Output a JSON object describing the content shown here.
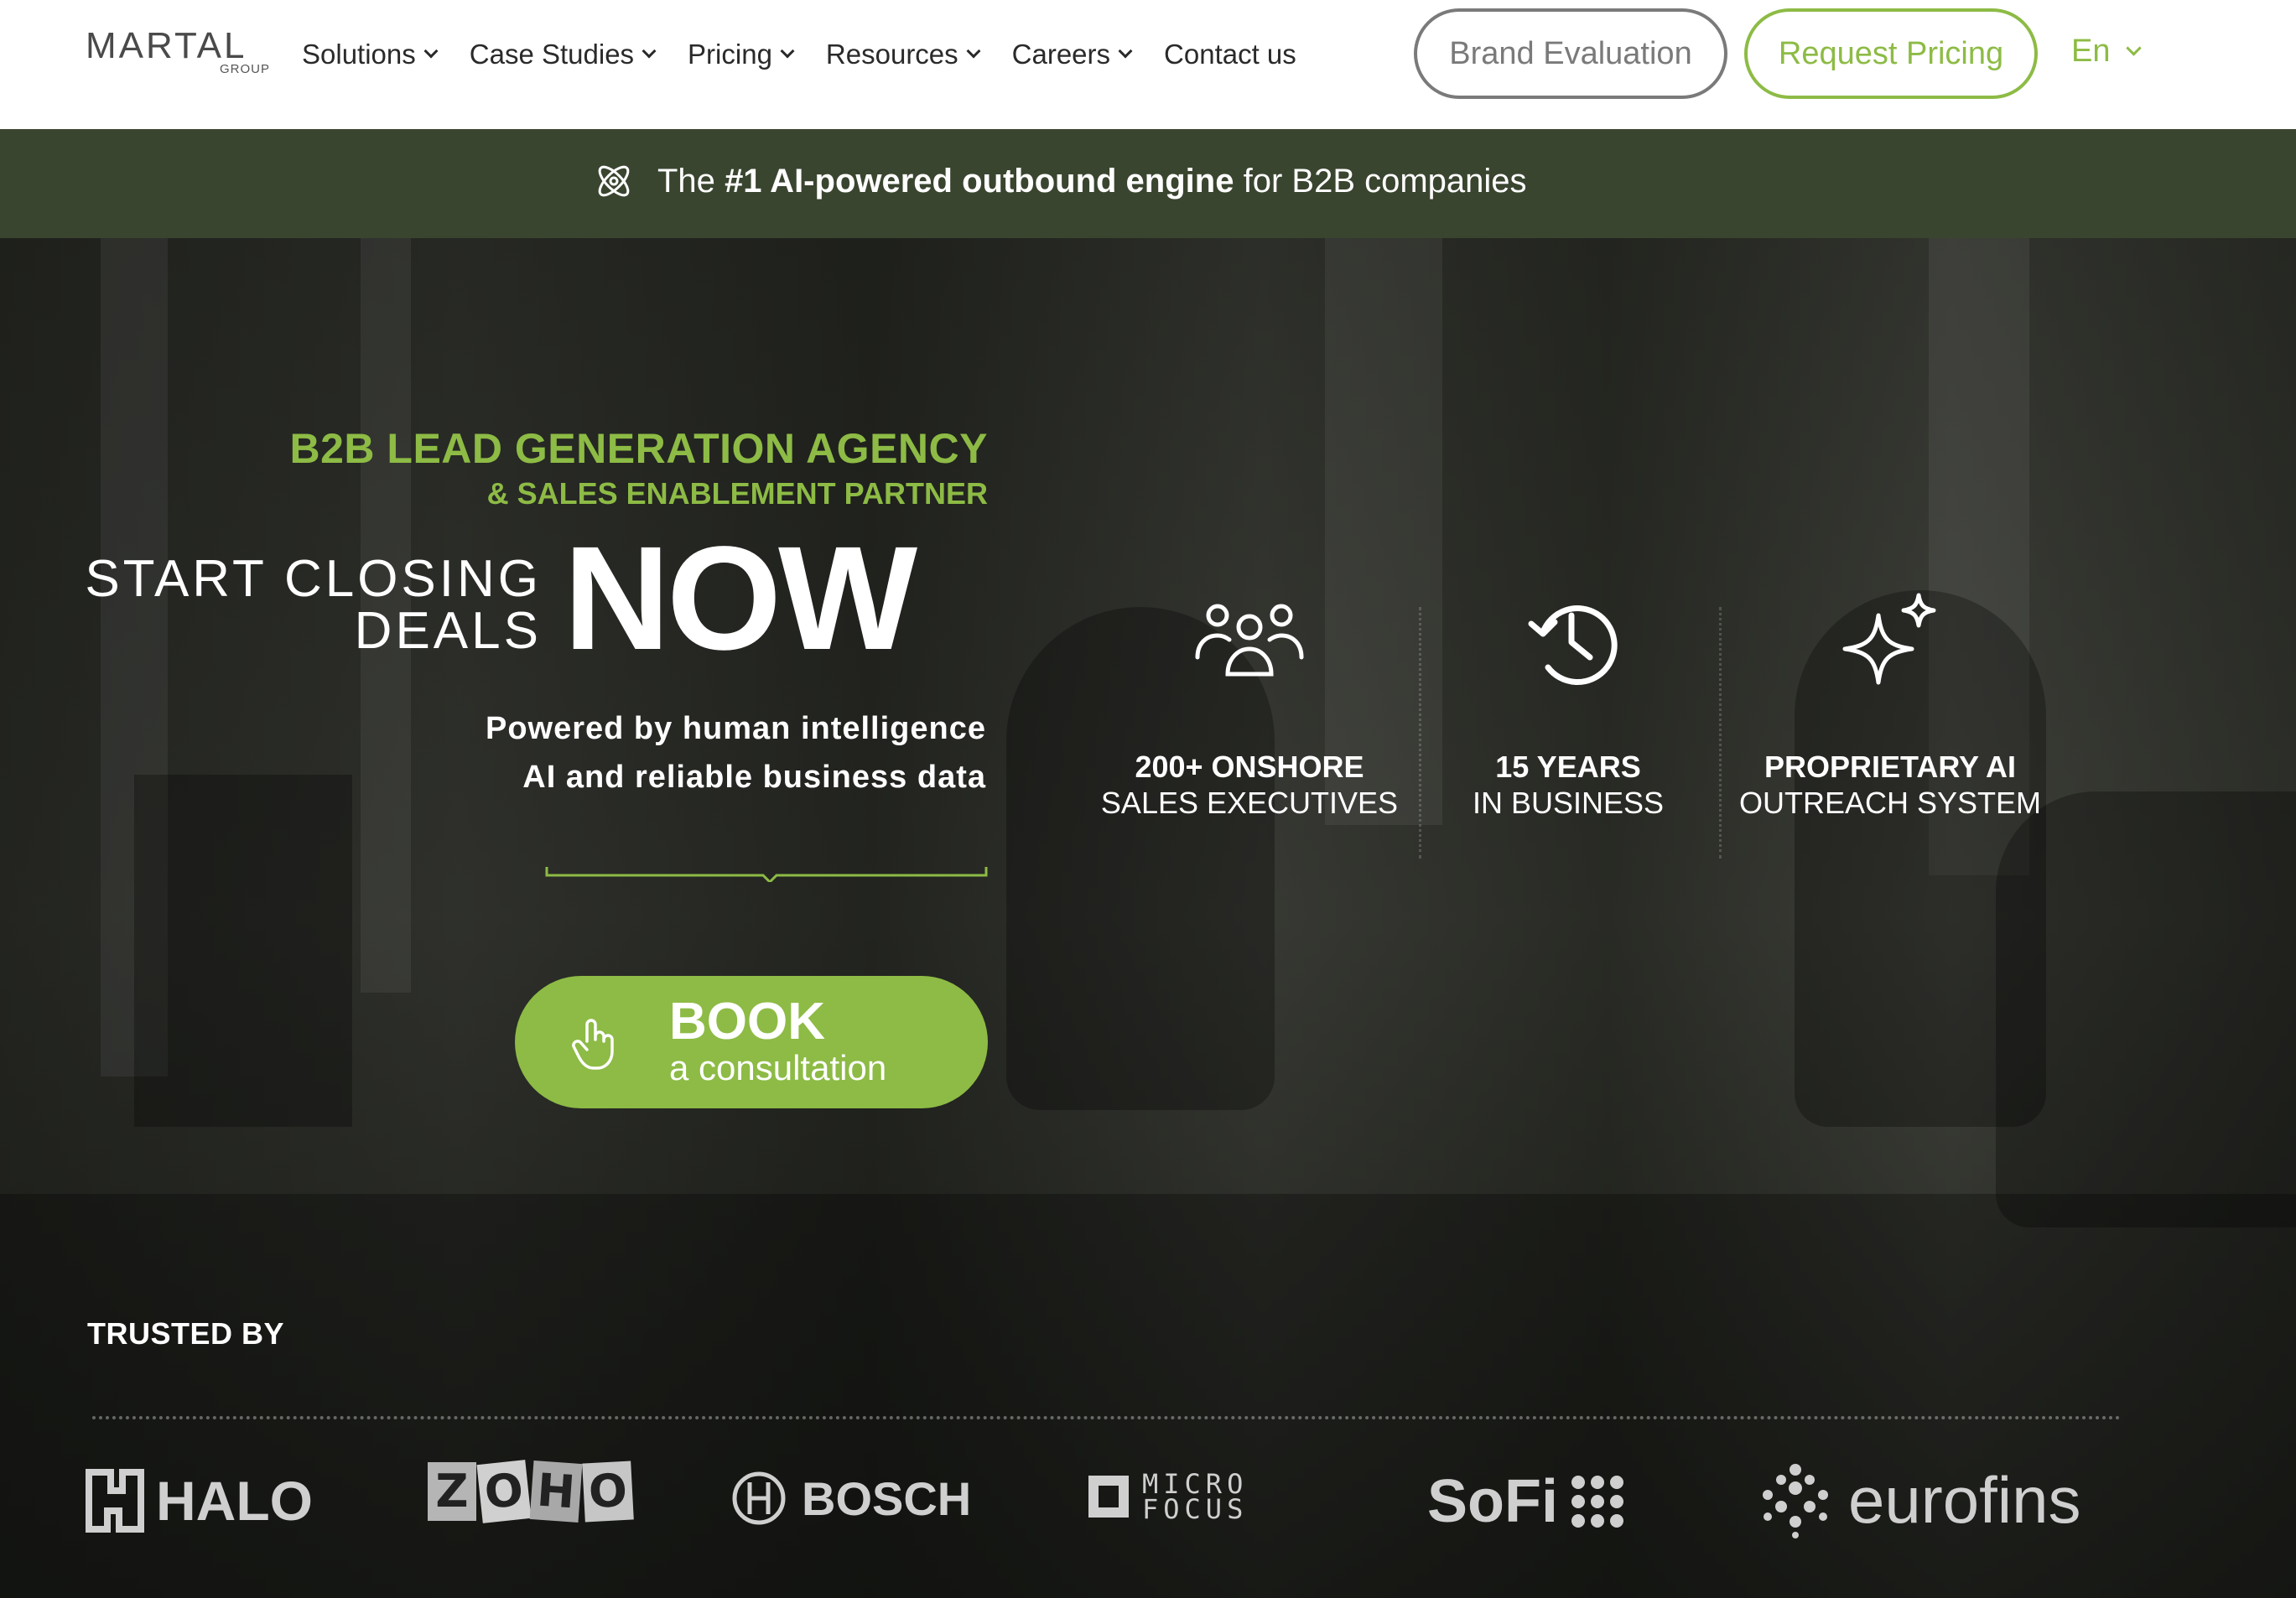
{
  "header": {
    "logo_main": "MARTAL",
    "logo_sub": "GROUP",
    "nav": [
      {
        "label": "Solutions"
      },
      {
        "label": "Case Studies"
      },
      {
        "label": "Pricing"
      },
      {
        "label": "Resources"
      },
      {
        "label": "Careers"
      },
      {
        "label": "Contact us"
      }
    ],
    "brand_evaluation_label": "Brand Evaluation",
    "request_pricing_label": "Request Pricing",
    "language": "En"
  },
  "banner": {
    "prefix": "The",
    "bold": "#1 AI-powered outbound engine",
    "suffix": "for B2B companies"
  },
  "hero": {
    "kicker": "B2B LEAD GENERATION AGENCY",
    "kicker_sub": "& SALES ENABLEMENT PARTNER",
    "start_line1": "START CLOSING",
    "start_line2": "DEALS",
    "now": "NOW",
    "power_line1": "Powered by human intelligence",
    "power_line2": "AI and reliable business data",
    "cta_main": "BOOK",
    "cta_sub": "a consultation",
    "stats": [
      {
        "bold": "200+ ONSHORE",
        "regular": "SALES EXECUTIVES",
        "icon": "team-icon"
      },
      {
        "bold": "15 YEARS",
        "regular": "IN BUSINESS",
        "icon": "history-clock-icon"
      },
      {
        "bold": "PROPRIETARY AI",
        "regular": "OUTREACH SYSTEM",
        "icon": "sparkle-icon"
      }
    ]
  },
  "trusted": {
    "label": "TRUSTED BY",
    "logos": {
      "halo": "HALO",
      "zoho": [
        "Z",
        "O",
        "H",
        "O"
      ],
      "bosch": "BOSCH",
      "micro_line1": "MICRO",
      "micro_line2": "FOCUS",
      "sofi": "SoFi",
      "eurofins": "eurofins"
    }
  },
  "colors": {
    "accent": "#8dbb45",
    "banner_bg": "#3a4530",
    "nav_text": "#2a2a2a"
  }
}
